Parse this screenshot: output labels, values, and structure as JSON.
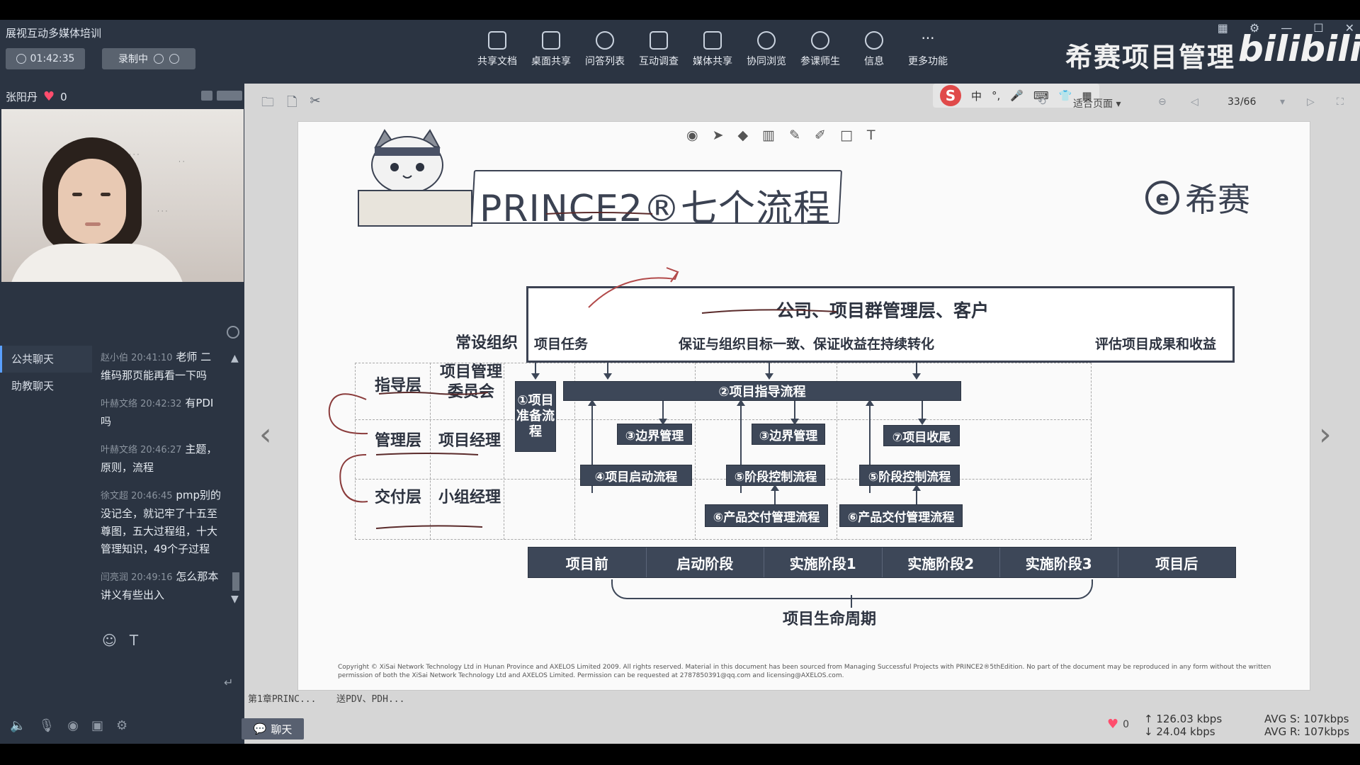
{
  "app": {
    "title": "展视互动多媒体培训",
    "timer": "01:42:35",
    "recording_label": "录制中"
  },
  "toolbar": {
    "items": [
      {
        "label": "共享文档",
        "icon": "document-icon"
      },
      {
        "label": "桌面共享",
        "icon": "desktop-share-icon"
      },
      {
        "label": "问答列表",
        "icon": "qa-icon"
      },
      {
        "label": "互动调查",
        "icon": "survey-icon"
      },
      {
        "label": "媒体共享",
        "icon": "media-icon"
      },
      {
        "label": "协同浏览",
        "icon": "browse-icon"
      },
      {
        "label": "参课师生",
        "icon": "participants-icon"
      },
      {
        "label": "信息",
        "icon": "info-icon"
      },
      {
        "label": "更多功能",
        "icon": "more-icon"
      }
    ]
  },
  "brand": {
    "cn": "希赛项目管理",
    "bili": "bilibili"
  },
  "presenter": {
    "name": "张阳丹",
    "likes": "0"
  },
  "chat": {
    "tabs": [
      "公共聊天",
      "助教聊天"
    ],
    "messages": [
      {
        "meta": "赵小伯 20:41:10",
        "text": "老师 二维码那页能再看一下吗"
      },
      {
        "meta": "叶赫文络 20:42:32",
        "text": "有PDI吗"
      },
      {
        "meta": "叶赫文络 20:46:27",
        "text": "主题，原则，流程"
      },
      {
        "meta": "徐文超 20:46:45",
        "text": "pmp别的没记全，就记牢了十五至尊图，五大过程组，十大管理知识，49个子过程"
      },
      {
        "meta": "闫亮润 20:49:16",
        "text": "怎么那本讲义有些出入"
      }
    ],
    "button": "聊天"
  },
  "ime": {
    "logo": "S",
    "items": [
      "中",
      "°,",
      "🎤",
      "⌨",
      "👕",
      "▦"
    ]
  },
  "viewer": {
    "fit_label": "适合页面",
    "page": "33/66"
  },
  "slide": {
    "title": "PRINCE2®七个流程",
    "logo_text": "希赛",
    "corp_title": "公司、项目群管理层、客户",
    "corp_subs": [
      "项目任务",
      "保证与组织目标一致、保证收益在持续转化",
      "评估项目成果和收益"
    ],
    "permanent_org": "常设组织",
    "layers": [
      {
        "level": "指导层",
        "role": "项目管理委员会"
      },
      {
        "level": "管理层",
        "role": "项目经理"
      },
      {
        "level": "交付层",
        "role": "小组经理"
      }
    ],
    "processes": {
      "p1": "①项目准备流程",
      "p2": "②项目指导流程",
      "p3a": "③边界管理",
      "p3b": "③边界管理",
      "p4": "④项目启动流程",
      "p5a": "⑤阶段控制流程",
      "p5b": "⑤阶段控制流程",
      "p6a": "⑥产品交付管理流程",
      "p6b": "⑥产品交付管理流程",
      "p7": "⑦项目收尾"
    },
    "phases": [
      "项目前",
      "启动阶段",
      "实施阶段1",
      "实施阶段2",
      "实施阶段3",
      "项目后"
    ],
    "lifecycle": "项目生命周期",
    "copyright": "Copyright © XiSai Network Technology Ltd in Hunan Province and AXELOS Limited 2009. All rights reserved. Material in this document has been sourced from Managing Successful Projects with PRINCE2®5thEdition. No part of the document may be reproduced in any form without the written permission of both the XiSai Network Technology Ltd and AXELOS Limited. Permission can be requested at 2787850391@qq.com and licensing@AXELOS.com."
  },
  "files": [
    "第1章PRINC...",
    "送PDV、PDH..."
  ],
  "stats": {
    "likes": "0",
    "up": "126.03 kbps",
    "down": "24.04 kbps",
    "avg_s": "AVG S: 107kbps",
    "avg_r": "AVG R: 107kbps"
  }
}
